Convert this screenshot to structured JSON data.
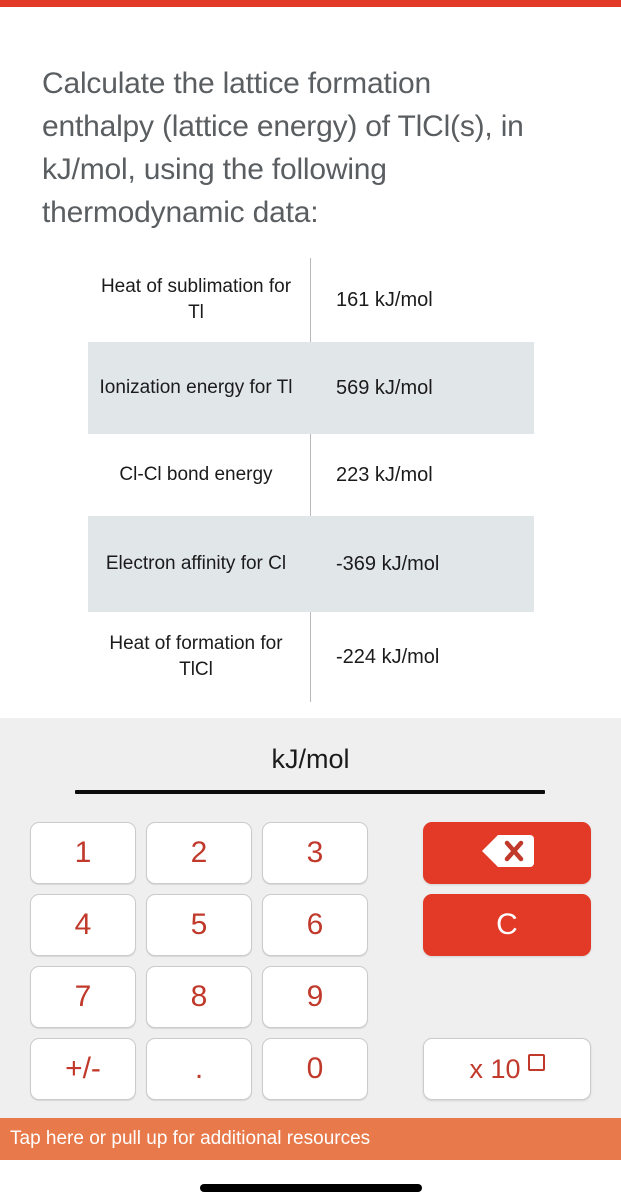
{
  "theme": {
    "accent_red": "#E33A27",
    "key_text_red": "#C0392B",
    "bottom_bar_orange": "#E8794A",
    "row_shade": "#E1E6E9",
    "panel_background": "#EFEFEF"
  },
  "question": {
    "text": "Calculate the lattice formation enthalpy (lattice energy) of TlCl(s), in kJ/mol, using the following thermodynamic data:"
  },
  "table": {
    "rows": [
      {
        "label": "Heat of sublimation for Tl",
        "value": "161 kJ/mol"
      },
      {
        "label": "Ionization energy for Tl",
        "value": "569 kJ/mol"
      },
      {
        "label": "Cl-Cl bond energy",
        "value": "223 kJ/mol"
      },
      {
        "label": "Electron affinity for Cl",
        "value": "-369 kJ/mol"
      },
      {
        "label": "Heat of formation for TlCl",
        "value": "-224 kJ/mol"
      }
    ]
  },
  "answer": {
    "unit_label": "kJ/mol",
    "value": "",
    "placeholder": ""
  },
  "keypad": {
    "rows": [
      [
        "1",
        "2",
        "3"
      ],
      [
        "4",
        "5",
        "6"
      ],
      [
        "7",
        "8",
        "9"
      ],
      [
        "+/-",
        ".",
        "0"
      ]
    ]
  },
  "actions": {
    "backspace_icon": "backspace-icon",
    "clear_label": "C",
    "exponent_label": "x 10",
    "exponent_placeholder_icon": "empty-square-icon"
  },
  "bottom_bar": {
    "text": "Tap here or pull up for additional resources"
  }
}
